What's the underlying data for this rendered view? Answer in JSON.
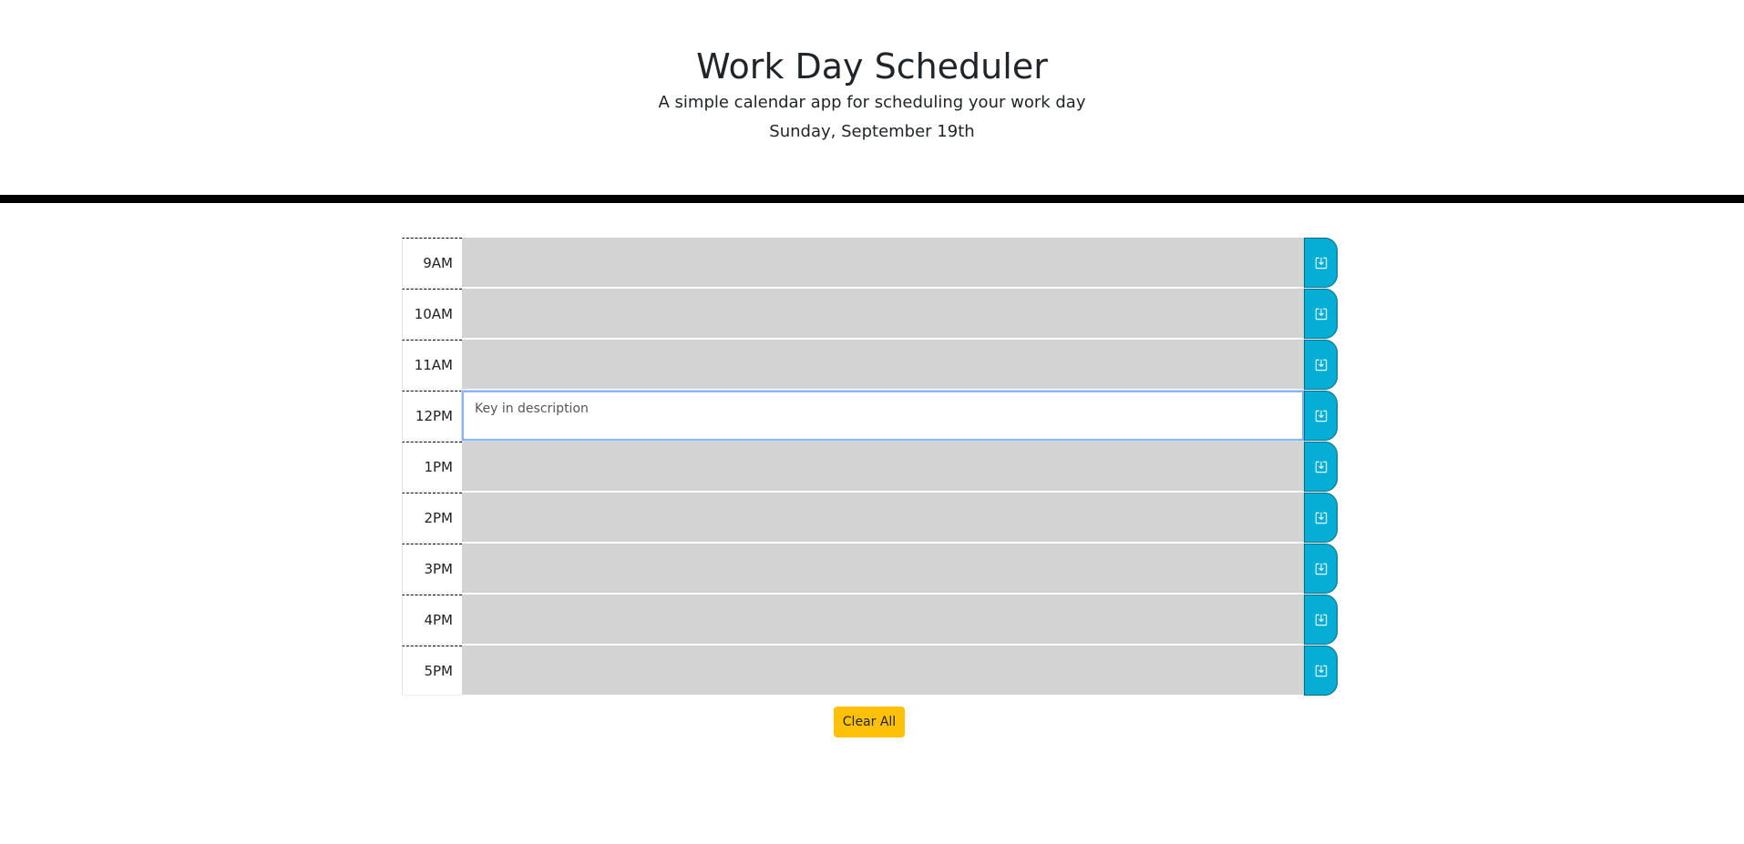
{
  "header": {
    "title": "Work Day Scheduler",
    "subtitle": "A simple calendar app for scheduling your work day",
    "current_day": "Sunday, September 19th"
  },
  "schedule": {
    "placeholder": "Key in description",
    "rows": [
      {
        "hour": "9AM",
        "text": ""
      },
      {
        "hour": "10AM",
        "text": ""
      },
      {
        "hour": "11AM",
        "text": ""
      },
      {
        "hour": "12PM",
        "text": ""
      },
      {
        "hour": "1PM",
        "text": ""
      },
      {
        "hour": "2PM",
        "text": ""
      },
      {
        "hour": "3PM",
        "text": ""
      },
      {
        "hour": "4PM",
        "text": ""
      },
      {
        "hour": "5PM",
        "text": ""
      }
    ],
    "save_icon": "save-icon"
  },
  "actions": {
    "clear_label": "Clear All"
  },
  "colors": {
    "past_block": "#d3d3d3",
    "save_button": "#06aed5",
    "clear_button": "#ffc107"
  }
}
